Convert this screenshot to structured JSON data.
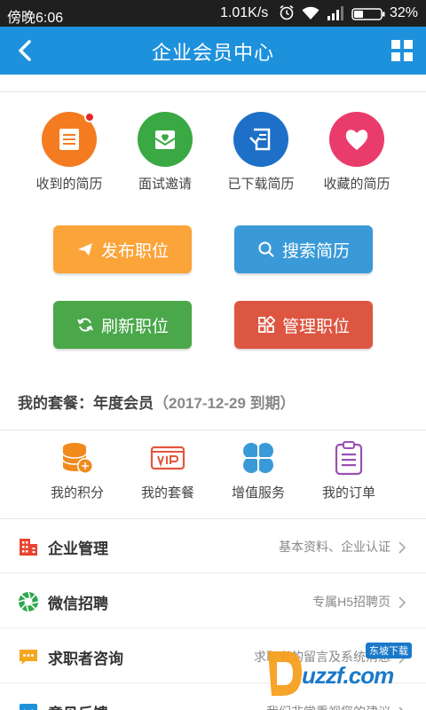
{
  "status_bar": {
    "left": "傍晚6:06",
    "speed": "1.01K/s",
    "battery": "32%"
  },
  "header": {
    "title": "企业会员中心"
  },
  "quick_actions": [
    {
      "label": "收到的简历",
      "icon": "resume-icon",
      "color": "#f47b20",
      "badge": true
    },
    {
      "label": "面试邀请",
      "icon": "invitation-envelope-icon",
      "color": "#3aa843",
      "badge": false
    },
    {
      "label": "已下载简历",
      "icon": "download-resume-icon",
      "color": "#1e6fc8",
      "badge": false
    },
    {
      "label": "收藏的简历",
      "icon": "heart-icon",
      "color": "#ea3c6b",
      "badge": false
    }
  ],
  "buttons": {
    "publish": "发布职位",
    "search": "搜索简历",
    "refresh": "刷新职位",
    "manage": "管理职位"
  },
  "plan": {
    "label": "我的套餐：年度会员",
    "expiry": "（2017-12-29 到期）"
  },
  "services": [
    {
      "label": "我的积分",
      "icon": "coins-icon"
    },
    {
      "label": "我的套餐",
      "icon": "vip-card-icon"
    },
    {
      "label": "增值服务",
      "icon": "clover-icon"
    },
    {
      "label": "我的订单",
      "icon": "clipboard-icon"
    }
  ],
  "list": [
    {
      "title": "企业管理",
      "sub": "基本资料、企业认证",
      "icon": "building-icon"
    },
    {
      "title": "微信招聘",
      "sub": "专属H5招聘页",
      "icon": "wechat-shutter-icon"
    },
    {
      "title": "求职者咨询",
      "sub": "求职者的留言及系统消息",
      "icon": "chat-bubble-icon"
    },
    {
      "title": "意见反馈",
      "sub": "我们非常重视您的建议",
      "icon": "feedback-icon"
    }
  ],
  "watermark": {
    "site": "uzzf.com",
    "tag": "东坡下载"
  },
  "colors": {
    "header": "#1e91dc",
    "orange": "#fba43a",
    "blue": "#3a9ad8",
    "green": "#4aa74a",
    "red": "#dd5642"
  }
}
